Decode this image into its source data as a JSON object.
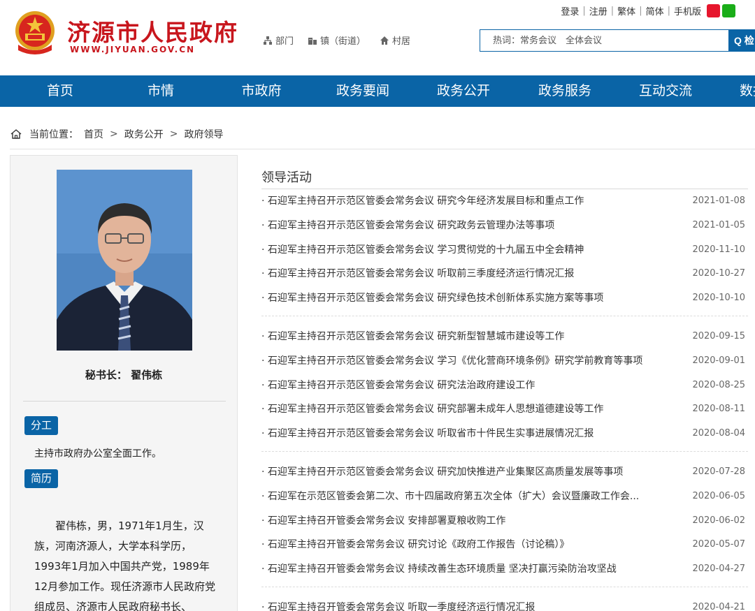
{
  "header": {
    "site_title": "济源市人民政府",
    "site_url": "WWW.JIYUAN.GOV.CN",
    "quick_links": [
      {
        "label": "部门",
        "icon": "org-chart-icon"
      },
      {
        "label": "镇（街道）",
        "icon": "building-icon"
      },
      {
        "label": "村居",
        "icon": "house-icon"
      }
    ],
    "top_links": [
      "登录",
      "注册",
      "繁体",
      "简体",
      "手机版"
    ],
    "search": {
      "placeholder": "热词：常务会议　全体会议",
      "button_label": "Q 检"
    }
  },
  "nav": {
    "items": [
      "首页",
      "市情",
      "市政府",
      "政务要闻",
      "政务公开",
      "政务服务",
      "互动交流",
      "数据"
    ]
  },
  "breadcrumb": {
    "prefix": "当前位置：",
    "items": [
      "首页",
      "政务公开",
      "政府领导"
    ],
    "separator": ">"
  },
  "profile": {
    "name": "秘书长：  翟伟栋",
    "duty_label": "分工",
    "duty_text": "主持市政府办公室全面工作。",
    "bio_label": "简历",
    "bio_text": "翟伟栋，男，1971年1月生，汉族，河南济源人，大学本科学历，1993年1月加入中国共产党，1989年12月参加工作。现任济源市人民政府党组成员、济源市人民政府秘书长、"
  },
  "activities": {
    "title": "领导活动",
    "groups": [
      [
        {
          "title": "· 石迎军主持召开示范区管委会常务会议 研究今年经济发展目标和重点工作",
          "date": "2021-01-08"
        },
        {
          "title": "· 石迎军主持召开示范区管委会常务会议 研究政务云管理办法等事项",
          "date": "2021-01-05"
        },
        {
          "title": "· 石迎军主持召开示范区管委会常务会议 学习贯彻党的十九届五中全会精神",
          "date": "2020-11-10"
        },
        {
          "title": "· 石迎军主持召开示范区管委会常务会议 听取前三季度经济运行情况汇报",
          "date": "2020-10-27"
        },
        {
          "title": "· 石迎军主持召开示范区管委会常务会议 研究绿色技术创新体系实施方案等事项",
          "date": "2020-10-10"
        }
      ],
      [
        {
          "title": "· 石迎军主持召开示范区管委会常务会议 研究新型智慧城市建设等工作",
          "date": "2020-09-15"
        },
        {
          "title": "· 石迎军主持召开示范区管委会常务会议 学习《优化营商环境条例》研究学前教育等事项",
          "date": "2020-09-01"
        },
        {
          "title": "· 石迎军主持召开示范区管委会常务会议 研究法治政府建设工作",
          "date": "2020-08-25"
        },
        {
          "title": "· 石迎军主持召开示范区管委会常务会议 研究部署未成年人思想道德建设等工作",
          "date": "2020-08-11"
        },
        {
          "title": "· 石迎军主持召开示范区管委会常务会议 听取省市十件民生实事进展情况汇报",
          "date": "2020-08-04"
        }
      ],
      [
        {
          "title": "· 石迎军主持召开示范区管委会常务会议 研究加快推进产业集聚区高质量发展等事项",
          "date": "2020-07-28"
        },
        {
          "title": "· 石迎军在示范区管委会第二次、市十四届政府第五次全体（扩大）会议暨廉政工作会...",
          "date": "2020-06-05"
        },
        {
          "title": "· 石迎军主持召开管委会常务会议 安排部署夏粮收购工作",
          "date": "2020-06-02"
        },
        {
          "title": "· 石迎军主持召开管委会常务会议 研究讨论《政府工作报告（讨论稿）》",
          "date": "2020-05-07"
        },
        {
          "title": "· 石迎军主持召开管委会常务会议 持续改善生态环境质量 坚决打赢污染防治攻坚战",
          "date": "2020-04-27"
        }
      ],
      [
        {
          "title": "· 石迎军主持召开管委会常务会议 听取一季度经济运行情况汇报",
          "date": "2020-04-21"
        }
      ]
    ]
  },
  "colors": {
    "brand_red": "#c8161d",
    "nav_blue": "#0a64a6"
  }
}
